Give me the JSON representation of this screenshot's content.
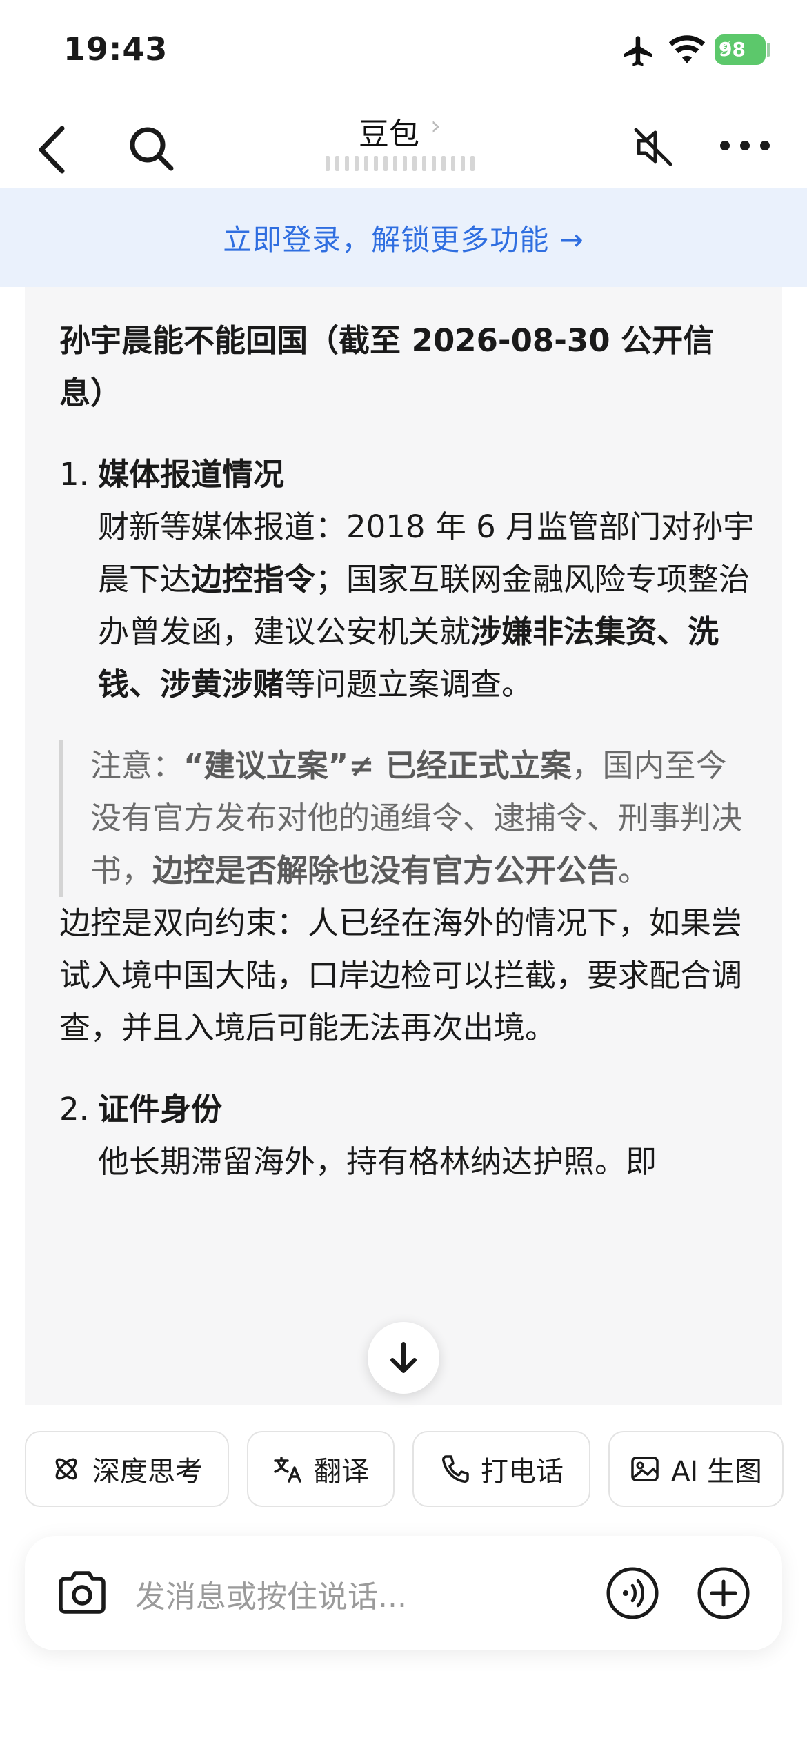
{
  "status_bar": {
    "time": "19:43",
    "battery": "98",
    "icons": [
      "airplane-icon",
      "wifi-icon",
      "battery-icon"
    ]
  },
  "nav": {
    "title": "豆包",
    "chevron": "›",
    "icons": [
      "back-icon",
      "search-icon",
      "mute-icon",
      "more-icon"
    ]
  },
  "banner": {
    "text": "立即登录，解锁更多功能 →"
  },
  "message": {
    "heading": "孙宇晨能不能回国（截至 2026-08-30 公开信息）",
    "sections": [
      {
        "number": "1.",
        "title": "媒体报道情况",
        "body_parts": [
          "财新等媒体报道：2018 年 6 月监管部门对孙宇晨下达",
          "边控指令",
          "；国家互联网金融风险专项整治办曾发函，建议公安机关就",
          "涉嫌非法集资、洗钱、涉黄涉赌",
          "等问题立案调查。"
        ]
      },
      {
        "number": "2.",
        "title": "证件身份",
        "body": "他长期滞留海外，持有格林纳达护照。即"
      }
    ],
    "note": {
      "prefix": "注意：",
      "b1": "“建议立案”≠ 已经正式立案",
      "mid": "，国内至今没有官方发布对他的通缉令、逮捕令、刑事判决书，",
      "b2": "边控是否解除也没有官方公开公告",
      "end": "。"
    },
    "paragraph": "边控是双向约束：人已经在海外的情况下，如果尝试入境中国大陆，口岸边检可以拦截，要求配合调查，并且入境后可能无法再次出境。"
  },
  "chips": [
    {
      "label": "深度思考",
      "icon": "atom-icon"
    },
    {
      "label": "翻译",
      "icon": "translate-icon"
    },
    {
      "label": "打电话",
      "icon": "phone-icon"
    },
    {
      "label": "AI 生图",
      "icon": "image-icon"
    }
  ],
  "input": {
    "placeholder": "发消息或按住说话...",
    "icons": [
      "camera-icon",
      "voice-icon",
      "plus-icon"
    ]
  },
  "colors": {
    "accent": "#2f6ee0",
    "banner_bg": "#eaf1fc",
    "card_bg": "#f6f6f7",
    "battery": "#5cc86b"
  }
}
